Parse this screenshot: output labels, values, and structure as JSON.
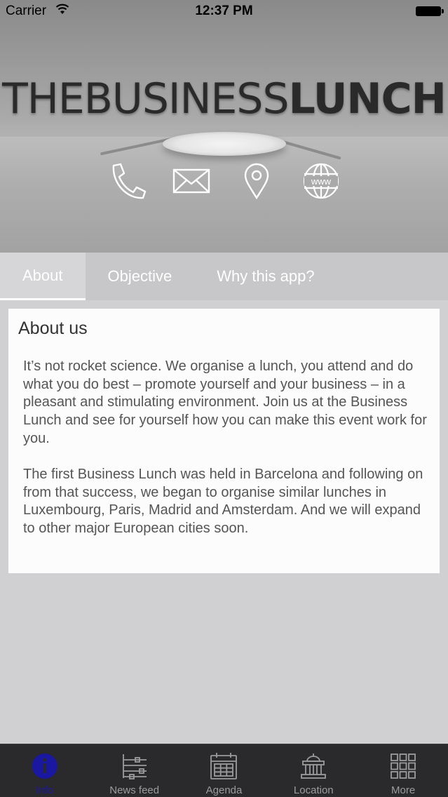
{
  "status_bar": {
    "carrier": "Carrier",
    "time": "12:37 PM"
  },
  "header": {
    "brand_light": "THEBUSINESS",
    "brand_bold": "LUNCH",
    "contact_icons": [
      "phone-icon",
      "mail-icon",
      "location-pin-icon",
      "globe-www-icon"
    ]
  },
  "tabs": [
    {
      "label": "About",
      "active": true
    },
    {
      "label": "Objective",
      "active": false
    },
    {
      "label": "Why this app?",
      "active": false
    }
  ],
  "card": {
    "title": "About us",
    "paragraphs": [
      "It’s not rocket science. We organise a lunch, you attend and do what you do best – promote yourself and your business – in a pleasant and stimulating environment. Join us at the Business Lunch and see for yourself how you can make this event work for you.",
      "The first Business Lunch was held in Barcelona and following on from that success, we began to organise similar lunches in Luxembourg, Paris, Madrid and Amsterdam. And we will expand to other major European cities soon."
    ]
  },
  "tabbar": [
    {
      "label": "Info",
      "icon": "info-icon",
      "active": true
    },
    {
      "label": "News feed",
      "icon": "news-feed-icon",
      "active": false
    },
    {
      "label": "Agenda",
      "icon": "calendar-icon",
      "active": false
    },
    {
      "label": "Location",
      "icon": "building-icon",
      "active": false
    },
    {
      "label": "More",
      "icon": "grid-icon",
      "active": false
    }
  ],
  "colors": {
    "active_tab_text": "#1a17a0",
    "inactive_tab_text": "#9b9b9d",
    "tabbar_bg": "#2a2a2c",
    "page_bg": "#d0cfd1"
  }
}
